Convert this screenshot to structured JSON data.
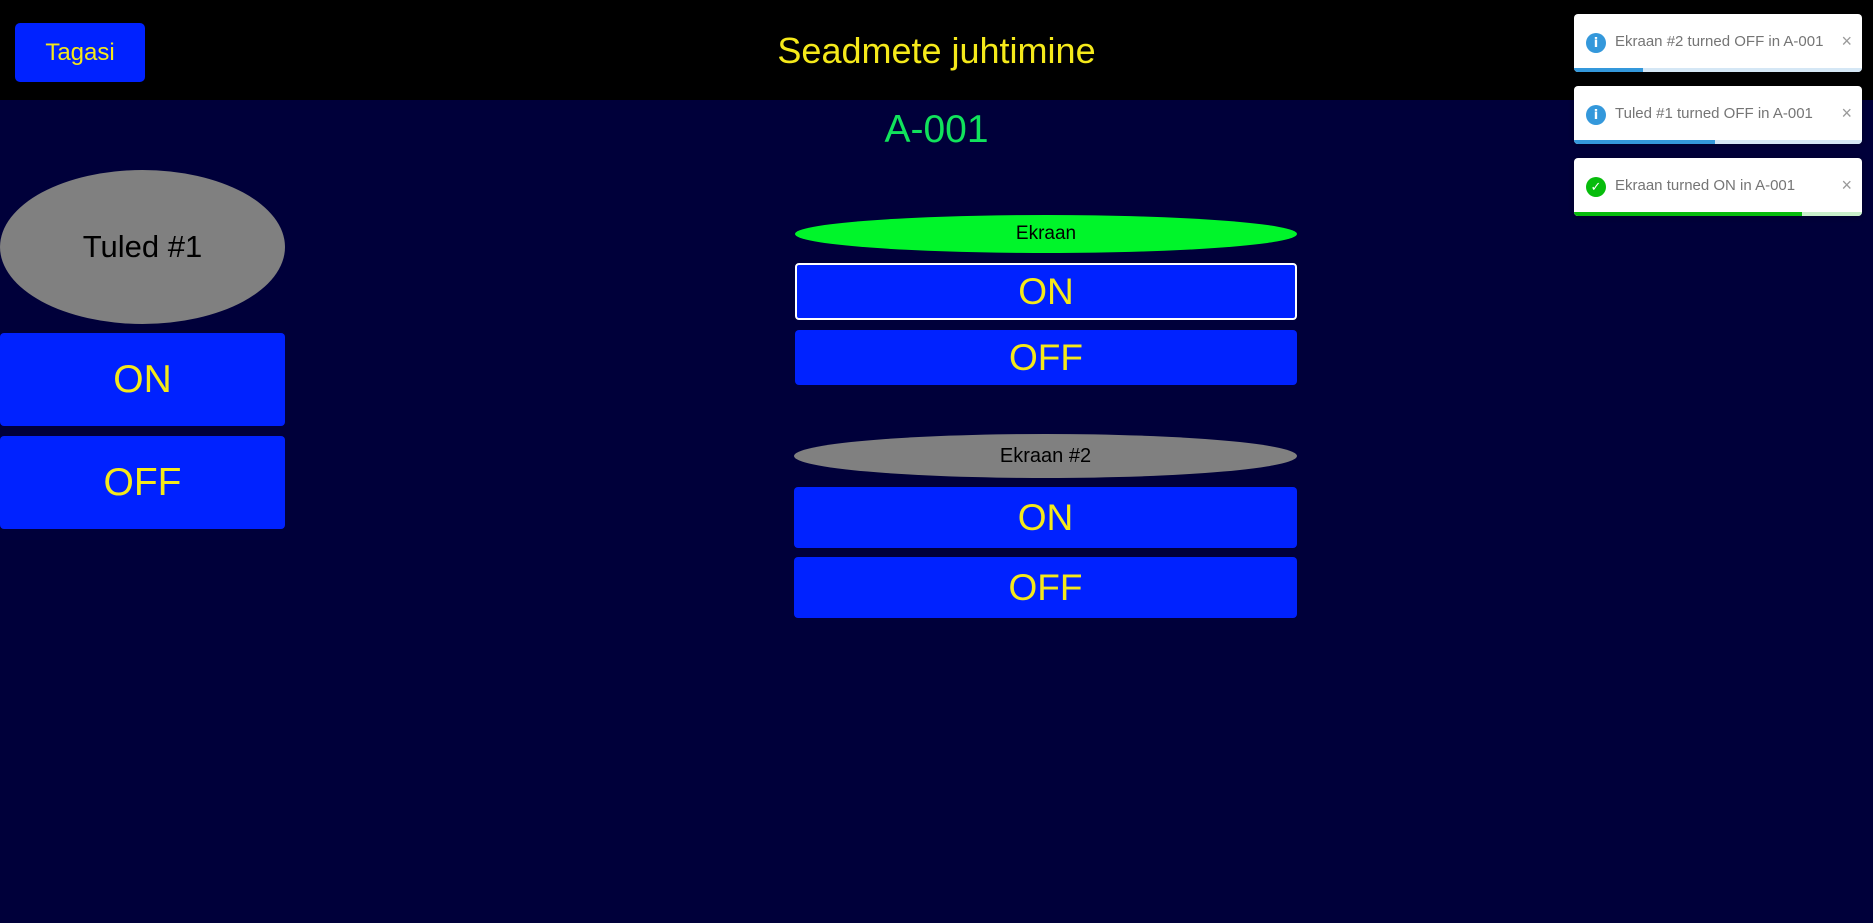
{
  "header": {
    "back_label": "Tagasi",
    "title": "Seadmete juhtimine"
  },
  "room": {
    "name": "A-001"
  },
  "colors": {
    "accent_button": "#0022ff",
    "button_text": "#f5e91a",
    "device_on": "#00f52a",
    "device_off": "#808080",
    "room_title": "#11e35c",
    "info": "#3498db",
    "success": "#07bc0c"
  },
  "devices": {
    "lights1": {
      "name": "Tuled #1",
      "status": "off",
      "on_label": "ON",
      "off_label": "OFF"
    },
    "screen1": {
      "name": "Ekraan",
      "status": "on",
      "on_label": "ON",
      "off_label": "OFF"
    },
    "screen2": {
      "name": "Ekraan #2",
      "status": "off",
      "on_label": "ON",
      "off_label": "OFF"
    }
  },
  "toasts": [
    {
      "type": "info",
      "icon": "info-icon",
      "message": "Ekraan #2 turned OFF in A-001",
      "close": "×",
      "progress": 0.24
    },
    {
      "type": "info",
      "icon": "info-icon",
      "message": "Tuled #1 turned OFF in A-001",
      "close": "×",
      "progress": 0.49
    },
    {
      "type": "success",
      "icon": "check-icon",
      "message": "Ekraan turned ON in A-001",
      "close": "×",
      "progress": 0.79
    }
  ]
}
